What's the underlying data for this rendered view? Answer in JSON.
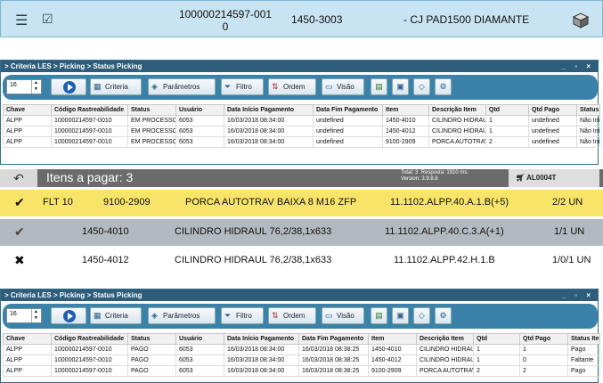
{
  "top_strip": {
    "code_line1": "100000214597-001",
    "code_line2": "0",
    "item": "1450-3003",
    "description": "- CJ PAD1500 DIAMANTE"
  },
  "panels": [
    {
      "breadcrumb": "> Criteria LES > Picking > Status Picking",
      "page_size": "16",
      "buttons": {
        "criteria": "Criteria",
        "parametros": "Parâmetros",
        "filtro": "Filtro",
        "ordem": "Ordem",
        "visao": "Visão"
      },
      "columns": [
        "Chave",
        "Código Rastreabilidade",
        "Status",
        "Usuário",
        "Data Início Pagamento",
        "Data Fim Pagamento",
        "Item",
        "Descrição Item",
        "Qtd",
        "Qtd Pago",
        "Status Item"
      ],
      "rows": [
        [
          "ALPP",
          "100000214597-0010",
          "EM PROCESSO",
          "6053",
          "16/03/2018 08:34:00",
          "undefined",
          "1450-4010",
          "CILINDRO HIDRAU",
          "1",
          "undefined",
          "Não Iniciado"
        ],
        [
          "ALPP",
          "100000214597-0010",
          "EM PROCESSO",
          "6053",
          "16/03/2018 08:34:00",
          "undefined",
          "1450-4012",
          "CILINDRO HIDRAU",
          "1",
          "undefined",
          "Não Iniciado"
        ],
        [
          "ALPP",
          "100000214597-0010",
          "EM PROCESSO",
          "6053",
          "16/03/2018 08:34:00",
          "undefined",
          "9100-2909",
          "PORCA AUTOTRAV",
          "2",
          "undefined",
          "Não Iniciado"
        ]
      ]
    },
    {
      "breadcrumb": "> Criteria LES > Picking > Status Picking",
      "page_size": "16",
      "buttons": {
        "criteria": "Criteria",
        "parametros": "Parâmetros",
        "filtro": "Filtro",
        "ordem": "Ordem",
        "visao": "Visão"
      },
      "columns": [
        "Chave",
        "Código Rastreabilidade",
        "Status",
        "Usuário",
        "Data Início Pagamento",
        "Data Fim Pagamento",
        "Item",
        "Descrição Item",
        "Qtd",
        "Qtd Pago",
        "Status Item"
      ],
      "rows": [
        [
          "ALPP",
          "100000214597-0010",
          "PAGO",
          "6053",
          "16/03/2018 08:34:00",
          "16/03/2018 08:38:25",
          "1450-4010",
          "CILINDRO HIDRAU",
          "1",
          "1",
          "Pago"
        ],
        [
          "ALPP",
          "100000214597-0010",
          "PAGO",
          "6053",
          "16/03/2018 08:34:00",
          "16/03/2018 08:38:25",
          "1450-4012",
          "CILINDRO HIDRAU",
          "1",
          "0",
          "Faltante"
        ],
        [
          "ALPP",
          "100000214597-0010",
          "PAGO",
          "6053",
          "16/03/2018 08:34:00",
          "16/03/2018 08:38:25",
          "9100-2909",
          "PORCA AUTOTRAV",
          "2",
          "2",
          "Pago"
        ]
      ]
    }
  ],
  "pay_header": {
    "title": "Itens a pagar: 3",
    "stats_line1": "Total: 3. Resposta: 1910 ms.",
    "stats_line2": "Version: 3.9.8.8",
    "user": "AL0004T"
  },
  "pay_items": [
    {
      "location": "FLT 10",
      "item": "9100-2909",
      "description": "PORCA AUTOTRAV BAIXA 8 M16 ZFP",
      "address": "11.1102.ALPP.40.A.1.B(+5)",
      "qty": "2/2 UN",
      "bg": "#f7e469"
    },
    {
      "location": "",
      "item": "1450-4010",
      "description": "CILINDRO HIDRAUL 76,2/38,1x633",
      "address": "11.1102.ALPP.40.C.3.A(+1)",
      "qty": "1/1 UN",
      "bg": "#b3b9c0"
    },
    {
      "location": "",
      "item": "1450-4012",
      "description": "CILINDRO HIDRAUL 76,2/38,1x633",
      "address": "11.1102.ALPP.42.H.1.B",
      "qty": "1/0/1 UN",
      "bg": "#ffffff"
    }
  ]
}
